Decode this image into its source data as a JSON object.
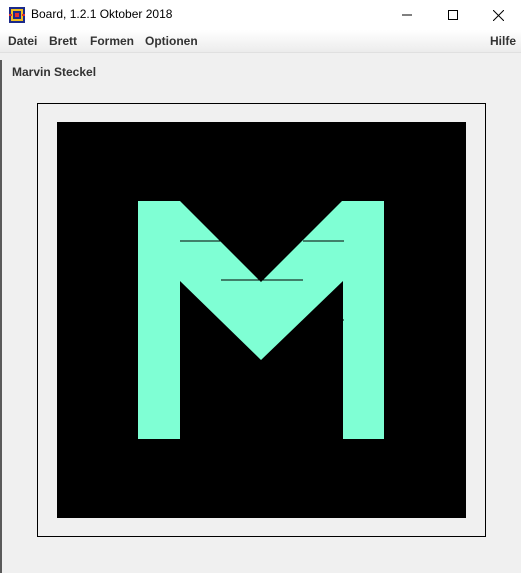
{
  "window": {
    "title": "Board, 1.2.1 Oktober 2018",
    "icon": "board-app-icon"
  },
  "menu": {
    "items": [
      "Datei",
      "Brett",
      "Formen",
      "Optionen"
    ],
    "help": "Hilfe"
  },
  "player": {
    "name": "Marvin Steckel"
  },
  "board": {
    "background_color": "#000000",
    "shape_color": "#7fffd4",
    "shape_letter": "M"
  }
}
